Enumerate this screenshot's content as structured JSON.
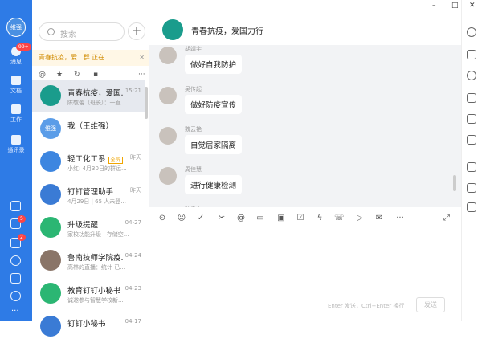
{
  "nav": {
    "avatar_text": "维强",
    "items": [
      {
        "label": "消息",
        "badge": "99+"
      },
      {
        "label": "文档"
      },
      {
        "label": "工作"
      },
      {
        "label": "通讯录"
      }
    ],
    "small_badges": [
      "5",
      "2"
    ]
  },
  "search": {
    "placeholder": "搜索"
  },
  "notice": {
    "text": "青春抗疫，爱...群 正在..."
  },
  "conversations": [
    {
      "name": "青春抗疫，爱国...",
      "time": "15:21",
      "preview": "陈敬蕾（班长）：一直...",
      "avatar_color": "#1a9c8c",
      "avatar_text": ""
    },
    {
      "name": "我（王维强）",
      "time": "",
      "preview": "",
      "avatar_color": "#5b9de8",
      "avatar_text": "维强"
    },
    {
      "name": "轻工化工系",
      "tag": "全员",
      "time": "昨天",
      "preview": "小红: 4月30日的群运...",
      "avatar_color": "#3d86e0",
      "avatar_text": ""
    },
    {
      "name": "钉钉管理助手",
      "time": "昨天",
      "preview": "4月29日 | 65 人未登...",
      "avatar_color": "#3a7bd5",
      "avatar_text": ""
    },
    {
      "name": "升级提醒",
      "time": "04-27",
      "preview": "家校功能升级 | 存储空...",
      "avatar_color": "#2bb673",
      "avatar_text": ""
    },
    {
      "name": "鲁南技师学院疫...",
      "time": "04-24",
      "preview": "高林的直播：统计 已...",
      "avatar_color": "#8a7568",
      "avatar_text": ""
    },
    {
      "name": "教育钉钉小秘书",
      "time": "04-23",
      "preview": "诚邀参与智慧学校新...",
      "avatar_color": "#2bb673",
      "avatar_text": ""
    },
    {
      "name": "钉钉小秘书",
      "time": "04-17",
      "preview": "",
      "avatar_color": "#3a7bd5",
      "avatar_text": ""
    }
  ],
  "chat": {
    "title": "青春抗疫，爱国力行",
    "messages": [
      {
        "sender": "胡靖宇",
        "text": "做好自我防护"
      },
      {
        "sender": "吴传起",
        "text": "做好防疫宣传"
      },
      {
        "sender": "魏云艳",
        "text": "自觉居家隔离"
      },
      {
        "sender": "周佳慧",
        "text": "进行健康检测"
      },
      {
        "sender": "孙贵山",
        "text": ""
      }
    ],
    "hint": "Enter 发送，Ctrl+Enter 换行",
    "send_label": "发送"
  },
  "window": {
    "minimize": "–",
    "maximize": "□",
    "close": "✕"
  }
}
